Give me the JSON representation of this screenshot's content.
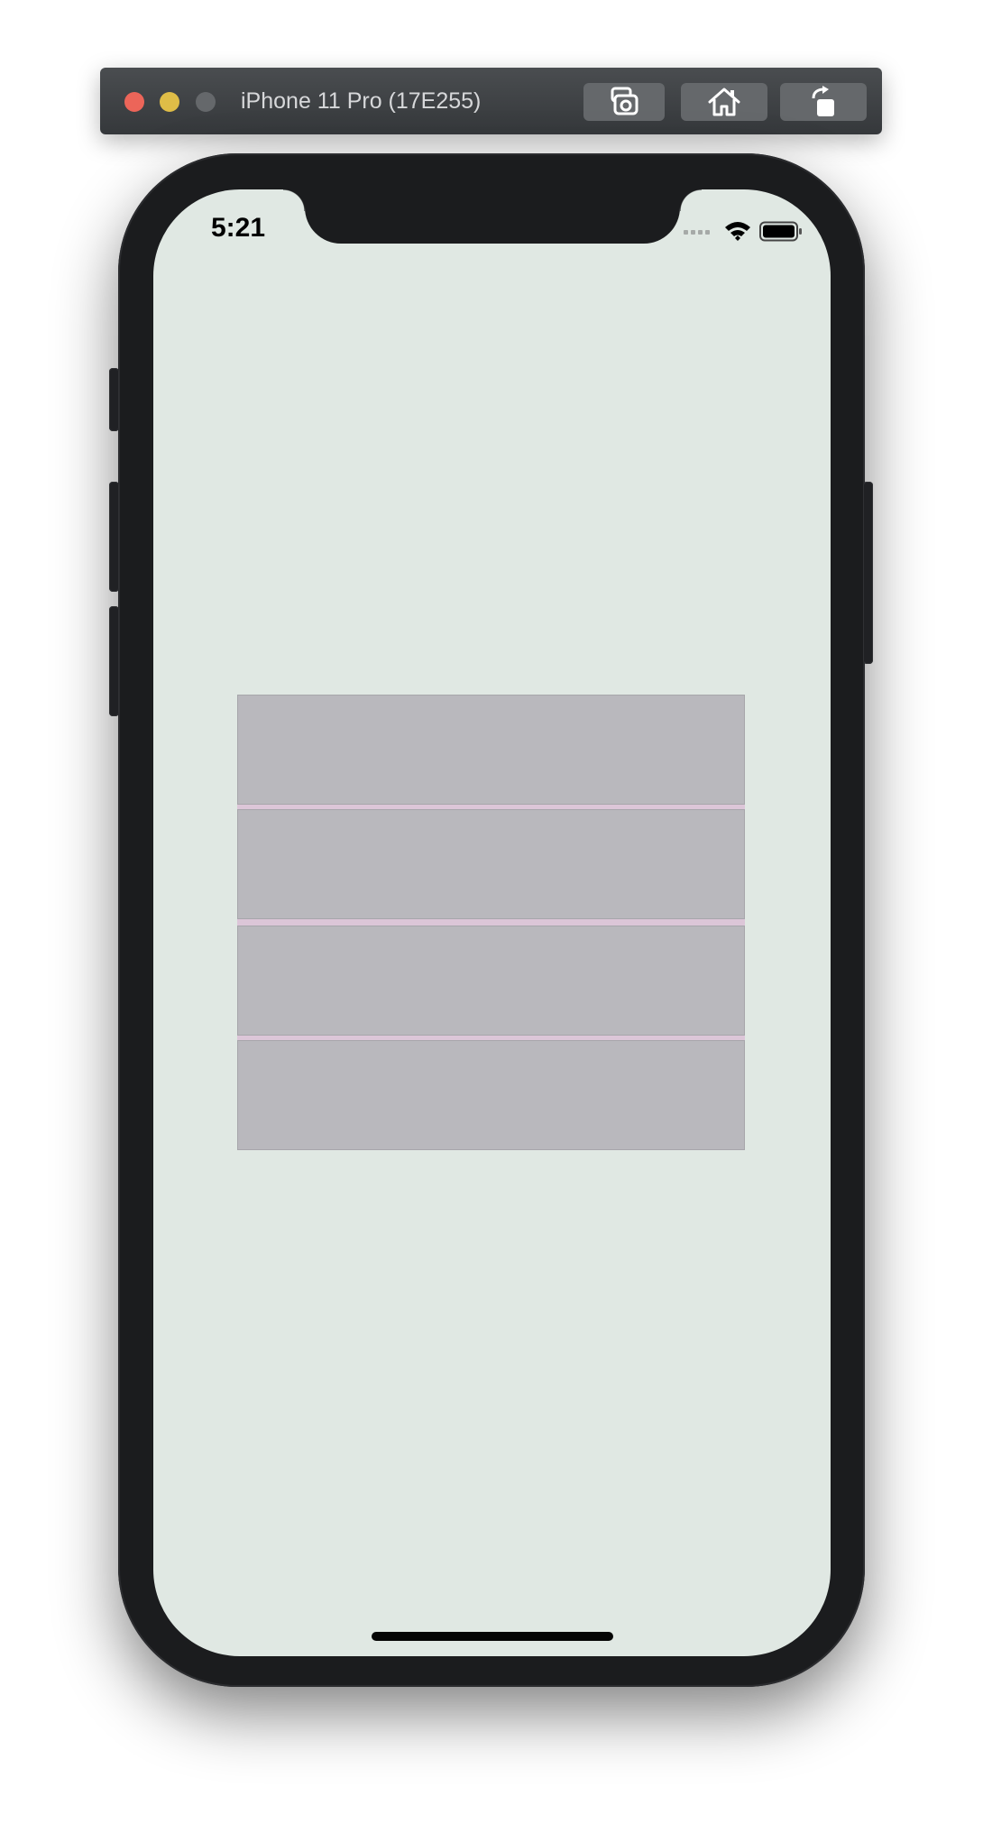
{
  "window": {
    "device_title": "iPhone 11 Pro (17E255)",
    "buttons": [
      {
        "icon": "screenshot-icon"
      },
      {
        "icon": "home-icon"
      },
      {
        "icon": "rotate-icon"
      }
    ]
  },
  "status_bar": {
    "time": "5:21",
    "icons": [
      "signal-icon",
      "wifi-icon",
      "battery-icon"
    ]
  },
  "content": {
    "rows": [
      {},
      {},
      {},
      {}
    ]
  },
  "colors": {
    "screen_background": "#e0e8e3",
    "row_fill": "#b9b8bd",
    "row_separator": "#dcc6d8",
    "device_frame": "#1b1c1e"
  }
}
